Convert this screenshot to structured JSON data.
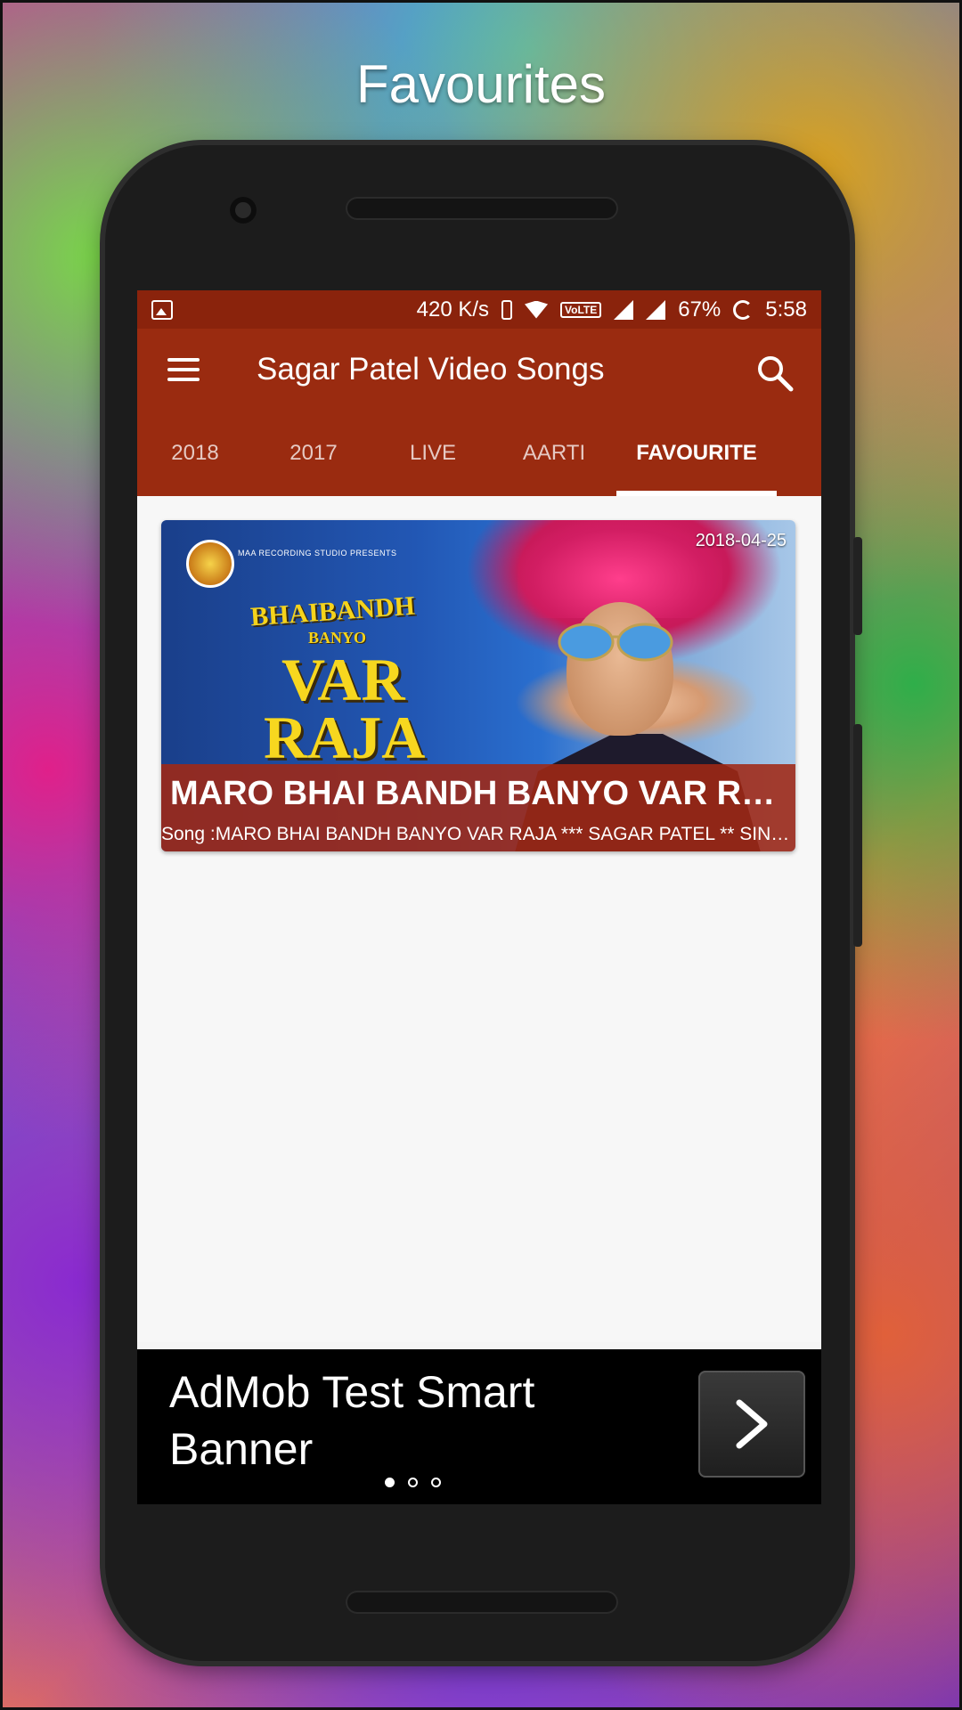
{
  "promo": {
    "title": "Favourites"
  },
  "status_bar": {
    "network_speed": "420 K/s",
    "volte": "VoLTE",
    "battery": "67%",
    "time": "5:58"
  },
  "toolbar": {
    "title": "Sagar Patel Video Songs"
  },
  "tabs": [
    {
      "label": "2018",
      "active": false
    },
    {
      "label": "2017",
      "active": false
    },
    {
      "label": "LIVE",
      "active": false
    },
    {
      "label": "AARTI",
      "active": false
    },
    {
      "label": "FAVOURITE",
      "active": true
    }
  ],
  "video": {
    "date": "2018-04-25",
    "title": "MARO BHAI BANDH  BANYO VAR RAJA",
    "subtitle": "Song :MARO BHAI BANDH  BANYO VAR RAJA *** SAGAR PATEL ** SINGER",
    "thumbnail_text": {
      "studio": "MAA RECORDING STUDIO PRESENTS",
      "line1": "BHAIBANDH",
      "line2": "BANYO",
      "line3": "VAR",
      "line4": "RAJA"
    }
  },
  "ad": {
    "text": "AdMob Test Smart Banner",
    "page_count": 3,
    "active_page": 1
  },
  "colors": {
    "primary": "#9a2b10",
    "status_bar": "#8a230c",
    "caption_bg": "#a02814"
  }
}
